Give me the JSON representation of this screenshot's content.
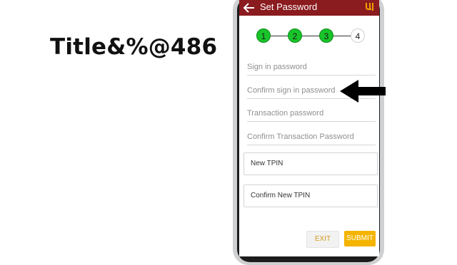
{
  "overlay": {
    "title": "Title&%@486"
  },
  "appbar": {
    "title": "Set Password",
    "logo_glyph": "ᴾ"
  },
  "stepper": {
    "steps": [
      "1",
      "2",
      "3",
      "4"
    ],
    "completed": 3
  },
  "fields": {
    "sign_in_password": "Sign in password",
    "confirm_sign_in_password": "Confirm sign in password",
    "transaction_password": "Transaction password",
    "confirm_transaction_password": "Confirm Transaction Password",
    "new_tpin": "New TPIN",
    "confirm_new_tpin": "Confirm New TPIN"
  },
  "buttons": {
    "exit": "EXIT",
    "submit": "SUBMIT"
  },
  "colors": {
    "appbar": "#8a1b1f",
    "step_done": "#19c42a",
    "submit": "#f4b400"
  }
}
